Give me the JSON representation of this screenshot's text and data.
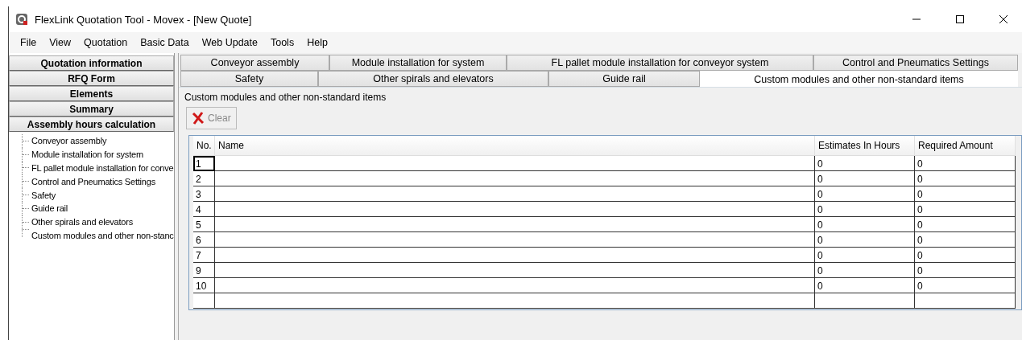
{
  "window": {
    "title": "FlexLink Quotation Tool - Movex - [New Quote]"
  },
  "menu": [
    "File",
    "View",
    "Quotation",
    "Basic Data",
    "Web Update",
    "Tools",
    "Help"
  ],
  "sidebar": {
    "sections": [
      "Quotation information",
      "RFQ Form",
      "Elements",
      "Summary",
      "Assembly hours calculation"
    ],
    "tree": [
      "Conveyor assembly",
      "Module installation for system",
      "FL pallet module installation for conve",
      "Control and Pneumatics Settings",
      "Safety",
      "Guide rail",
      "Other spirals and elevators",
      "Custom modules and other non-stanc"
    ]
  },
  "tabs": [
    [
      {
        "label": "Conveyor assembly",
        "selected": false
      },
      {
        "label": "Module installation for system",
        "selected": false
      },
      {
        "label": "FL pallet module installation for conveyor system",
        "selected": false
      },
      {
        "label": "Control and Pneumatics Settings",
        "selected": false
      }
    ],
    [
      {
        "label": "Safety",
        "selected": false
      },
      {
        "label": "Other spirals and elevators",
        "selected": false
      },
      {
        "label": "Guide rail",
        "selected": false
      },
      {
        "label": "Custom modules and other non-standard items",
        "selected": true
      }
    ]
  ],
  "group": {
    "title": "Custom modules and other non-standard items",
    "clear_button": {
      "label": "Clear",
      "disabled": true
    }
  },
  "table": {
    "columns": [
      "No.",
      "Name",
      "Estimates In Hours",
      "Required Amount"
    ],
    "rows": [
      {
        "no": "1",
        "name": "",
        "hours": "0",
        "amount": "0",
        "selected": true
      },
      {
        "no": "2",
        "name": "",
        "hours": "0",
        "amount": "0",
        "selected": false
      },
      {
        "no": "3",
        "name": "",
        "hours": "0",
        "amount": "0",
        "selected": false
      },
      {
        "no": "4",
        "name": "",
        "hours": "0",
        "amount": "0",
        "selected": false
      },
      {
        "no": "5",
        "name": "",
        "hours": "0",
        "amount": "0",
        "selected": false
      },
      {
        "no": "6",
        "name": "",
        "hours": "0",
        "amount": "0",
        "selected": false
      },
      {
        "no": "7",
        "name": "",
        "hours": "0",
        "amount": "0",
        "selected": false
      },
      {
        "no": "9",
        "name": "",
        "hours": "0",
        "amount": "0",
        "selected": false
      },
      {
        "no": "10",
        "name": "",
        "hours": "0",
        "amount": "0",
        "selected": false
      }
    ]
  }
}
